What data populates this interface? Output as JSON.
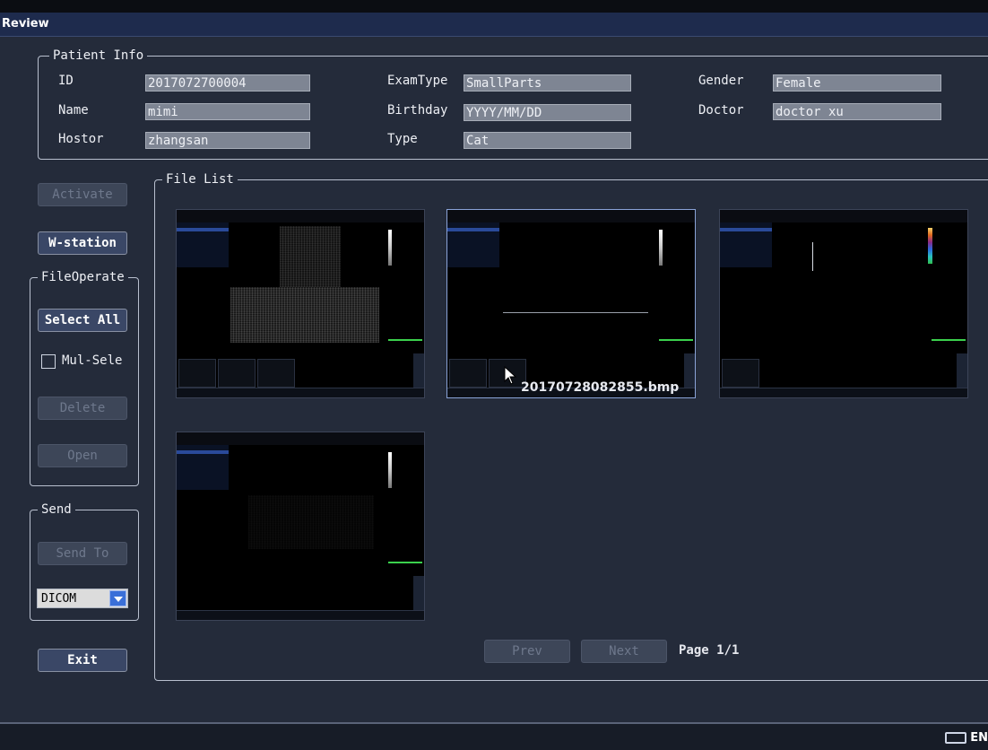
{
  "window": {
    "title": "Review"
  },
  "patient_info": {
    "legend": "Patient Info",
    "fields": [
      {
        "label": "ID",
        "value": "2017072700004"
      },
      {
        "label": "Name",
        "value": "mimi"
      },
      {
        "label": "Hostor",
        "value": "zhangsan"
      },
      {
        "label": "ExamType",
        "value": "SmallParts"
      },
      {
        "label": "Birthday",
        "value": "YYYY/MM/DD"
      },
      {
        "label": "Type",
        "value": "Cat"
      },
      {
        "label": "Gender",
        "value": "Female"
      },
      {
        "label": "Doctor",
        "value": "doctor xu"
      }
    ]
  },
  "sidebar": {
    "activate": "Activate",
    "wstation": "W-station",
    "fileoperate": {
      "legend": "FileOperate",
      "select_all": "Select All",
      "mulsele": "Mul-Sele",
      "delete": "Delete",
      "open": "Open"
    },
    "send": {
      "legend": "Send",
      "send_to": "Send To",
      "format": "DICOM"
    },
    "exit": "Exit"
  },
  "file_list": {
    "legend": "File List",
    "selected_filename": "20170728082855.bmp",
    "prev": "Prev",
    "next": "Next",
    "page": "Page 1/1"
  },
  "statusbar": {
    "ime": "EN"
  }
}
